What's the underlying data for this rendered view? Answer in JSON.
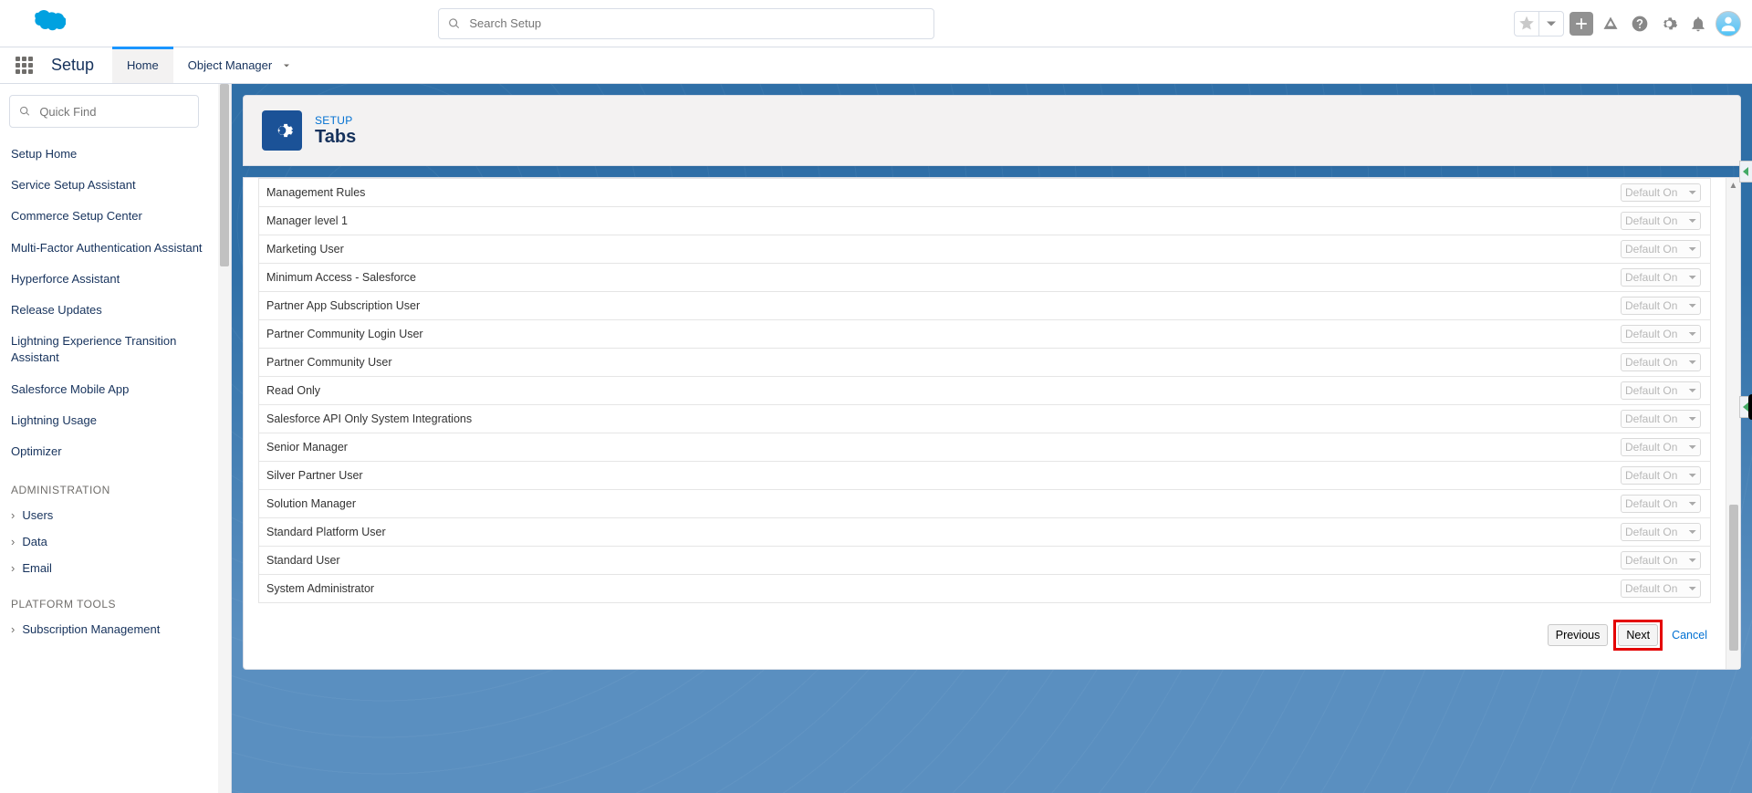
{
  "header": {
    "search_placeholder": "Search Setup"
  },
  "context": {
    "app_name": "Setup",
    "tabs": [
      {
        "label": "Home",
        "active": true
      },
      {
        "label": "Object Manager",
        "active": false,
        "dropdown": true
      }
    ]
  },
  "sidebar": {
    "quickfind_placeholder": "Quick Find",
    "links": [
      "Setup Home",
      "Service Setup Assistant",
      "Commerce Setup Center",
      "Multi-Factor Authentication Assistant",
      "Hyperforce Assistant",
      "Release Updates",
      "Lightning Experience Transition Assistant",
      "Salesforce Mobile App",
      "Lightning Usage",
      "Optimizer"
    ],
    "sections": [
      {
        "title": "ADMINISTRATION",
        "items": [
          "Users",
          "Data",
          "Email"
        ]
      },
      {
        "title": "PLATFORM TOOLS",
        "items": [
          "Subscription Management"
        ]
      }
    ]
  },
  "page": {
    "breadcrumb": "SETUP",
    "title": "Tabs"
  },
  "profiles": {
    "default_value": "Default On",
    "rows": [
      "Management Rules",
      "Manager level 1",
      "Marketing User",
      "Minimum Access - Salesforce",
      "Partner App Subscription User",
      "Partner Community Login User",
      "Partner Community User",
      "Read Only",
      "Salesforce API Only System Integrations",
      "Senior Manager",
      "Silver Partner User",
      "Solution Manager",
      "Standard Platform User",
      "Standard User",
      "System Administrator"
    ]
  },
  "actions": {
    "previous": "Previous",
    "next": "Next",
    "cancel": "Cancel"
  }
}
